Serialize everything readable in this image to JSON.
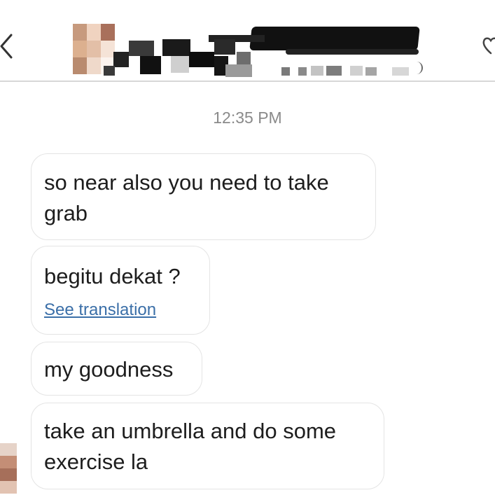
{
  "header": {
    "back_icon": "chevron-left-icon",
    "info_icon": "heart-icon",
    "avatar_pixels": [
      "#c79a7e",
      "#f0d3c0",
      "#a9705b",
      "#dcb08f",
      "#e3bfa7",
      "#f5e3d7",
      "#b98b6f",
      "#efd9ca",
      "#fbf3ee"
    ]
  },
  "chat": {
    "timestamp": "12:35 PM",
    "messages": [
      {
        "text": "so near also you need to take grab"
      },
      {
        "text": "begitu dekat ?",
        "translation_link": "See translation"
      },
      {
        "text": "my goodness"
      },
      {
        "text": "take an umbrella and do some exercise la"
      }
    ],
    "sender_avatar_pixels": [
      "#e6d3c8",
      "#c48e76",
      "#a66f5a",
      "#e2c3b2"
    ]
  },
  "colors": {
    "divider": "#d7d7d7",
    "bubble_border": "#e4e4e4",
    "link": "#3b6fa8",
    "timestamp": "#8a8a8a"
  }
}
